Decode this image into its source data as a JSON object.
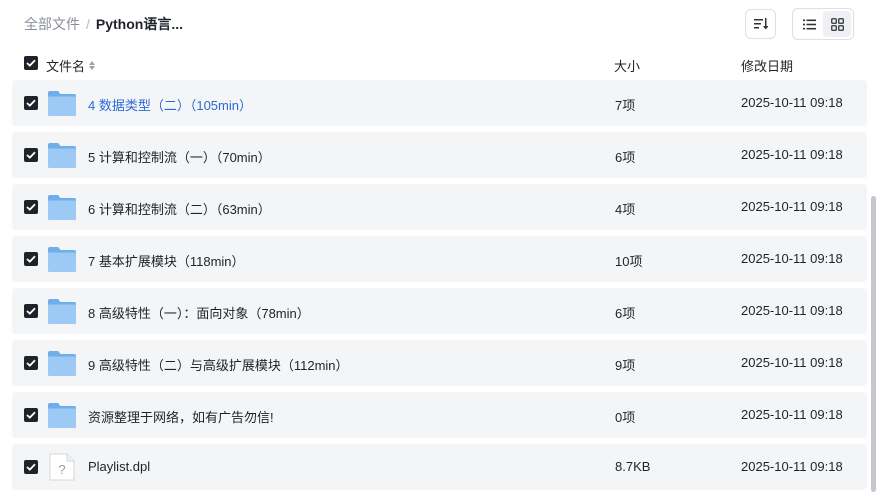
{
  "breadcrumb": {
    "root": "全部文件",
    "separator": "/",
    "current": "Python语言..."
  },
  "toolbar": {
    "sort_icon": "sort-list-icon",
    "view_list_icon": "list-view-icon",
    "view_grid_icon": "grid-view-icon",
    "active_view": "list"
  },
  "table": {
    "headers": {
      "name": "文件名",
      "size": "大小",
      "date": "修改日期"
    },
    "rows": [
      {
        "icon": "folder-icon",
        "name": "4 数据类型（二）（105min）",
        "size": "7项",
        "date": "2025-10-11 09:18",
        "checked": true,
        "highlight": true
      },
      {
        "icon": "folder-icon",
        "name": "5 计算和控制流（一）（70min）",
        "size": "6项",
        "date": "2025-10-11 09:18",
        "checked": true
      },
      {
        "icon": "folder-icon",
        "name": "6 计算和控制流（二）（63min）",
        "size": "4项",
        "date": "2025-10-11 09:18",
        "checked": true
      },
      {
        "icon": "folder-icon",
        "name": "7 基本扩展模块（118min）",
        "size": "10项",
        "date": "2025-10-11 09:18",
        "checked": true
      },
      {
        "icon": "folder-icon",
        "name": "8 高级特性（一）：面向对象（78min）",
        "size": "6项",
        "date": "2025-10-11 09:18",
        "checked": true
      },
      {
        "icon": "folder-icon",
        "name": "9 高级特性（二）与高级扩展模块（112min）",
        "size": "9项",
        "date": "2025-10-11 09:18",
        "checked": true
      },
      {
        "icon": "folder-icon",
        "name": "资源整理于网络，如有广告勿信!",
        "size": "0项",
        "date": "2025-10-11 09:18",
        "checked": true
      },
      {
        "icon": "unknown-file-icon",
        "name": "Playlist.dpl",
        "size": "8.7KB",
        "date": "2025-10-11 09:18",
        "checked": true
      }
    ]
  },
  "colors": {
    "row_bg": "#f4f5f7",
    "link": "#2a6ad8",
    "folder_blue": "#7fb8f0"
  }
}
